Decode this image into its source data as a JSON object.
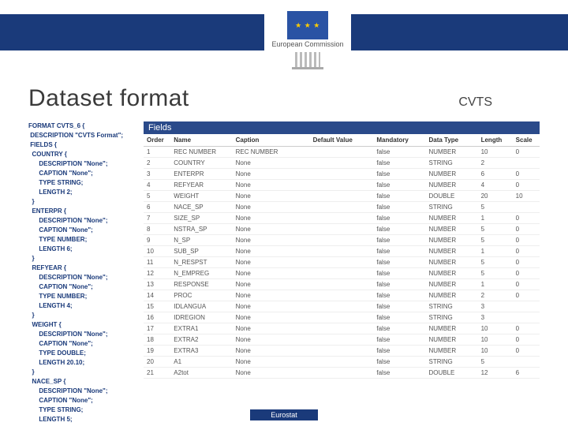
{
  "logo": {
    "caption": "European\nCommission",
    "stars": "★"
  },
  "title": "Dataset format",
  "tag": "CVTS",
  "fields_header": "Fields",
  "code_text": "FORMAT CVTS_6 {\n DESCRIPTION \"CVTS Format\";\n FIELDS {\n  COUNTRY {\n      DESCRIPTION \"None\";\n      CAPTION \"None\";\n      TYPE STRING;\n      LENGTH 2;\n  }\n  ENTERPR {\n      DESCRIPTION \"None\";\n      CAPTION \"None\";\n      TYPE NUMBER;\n      LENGTH 6;\n  }\n  REFYEAR {\n      DESCRIPTION \"None\";\n      CAPTION \"None\";\n      TYPE NUMBER;\n      LENGTH 4;\n  }\n  WEIGHT {\n      DESCRIPTION \"None\";\n      CAPTION \"None\";\n      TYPE DOUBLE;\n      LENGTH 20.10;\n  }\n  NACE_SP {\n      DESCRIPTION \"None\";\n      CAPTION \"None\";\n      TYPE STRING;\n      LENGTH 5;\n",
  "columns": [
    "Order",
    "Name",
    "Caption",
    "Default Value",
    "Mandatory",
    "Data Type",
    "Length",
    "Scale"
  ],
  "rows": [
    {
      "order": 1,
      "name": "REC NUMBER",
      "caption": "REC NUMBER",
      "def": "",
      "mand": "false",
      "type": "NUMBER",
      "len": "10",
      "sca": "0"
    },
    {
      "order": 2,
      "name": "COUNTRY",
      "caption": "None",
      "def": "",
      "mand": "false",
      "type": "STRING",
      "len": "2",
      "sca": ""
    },
    {
      "order": 3,
      "name": "ENTERPR",
      "caption": "None",
      "def": "",
      "mand": "false",
      "type": "NUMBER",
      "len": "6",
      "sca": "0"
    },
    {
      "order": 4,
      "name": "REFYEAR",
      "caption": "None",
      "def": "",
      "mand": "false",
      "type": "NUMBER",
      "len": "4",
      "sca": "0"
    },
    {
      "order": 5,
      "name": "WEIGHT",
      "caption": "None",
      "def": "",
      "mand": "false",
      "type": "DOUBLE",
      "len": "20",
      "sca": "10"
    },
    {
      "order": 6,
      "name": "NACE_SP",
      "caption": "None",
      "def": "",
      "mand": "false",
      "type": "STRING",
      "len": "5",
      "sca": ""
    },
    {
      "order": 7,
      "name": "SIZE_SP",
      "caption": "None",
      "def": "",
      "mand": "false",
      "type": "NUMBER",
      "len": "1",
      "sca": "0"
    },
    {
      "order": 8,
      "name": "NSTRA_SP",
      "caption": "None",
      "def": "",
      "mand": "false",
      "type": "NUMBER",
      "len": "5",
      "sca": "0"
    },
    {
      "order": 9,
      "name": "N_SP",
      "caption": "None",
      "def": "",
      "mand": "false",
      "type": "NUMBER",
      "len": "5",
      "sca": "0"
    },
    {
      "order": 10,
      "name": "SUB_SP",
      "caption": "None",
      "def": "",
      "mand": "false",
      "type": "NUMBER",
      "len": "1",
      "sca": "0"
    },
    {
      "order": 11,
      "name": "N_RESPST",
      "caption": "None",
      "def": "",
      "mand": "false",
      "type": "NUMBER",
      "len": "5",
      "sca": "0"
    },
    {
      "order": 12,
      "name": "N_EMPREG",
      "caption": "None",
      "def": "",
      "mand": "false",
      "type": "NUMBER",
      "len": "5",
      "sca": "0"
    },
    {
      "order": 13,
      "name": "RESPONSE",
      "caption": "None",
      "def": "",
      "mand": "false",
      "type": "NUMBER",
      "len": "1",
      "sca": "0"
    },
    {
      "order": 14,
      "name": "PROC",
      "caption": "None",
      "def": "",
      "mand": "false",
      "type": "NUMBER",
      "len": "2",
      "sca": "0"
    },
    {
      "order": 15,
      "name": "IDLANGUA",
      "caption": "None",
      "def": "",
      "mand": "false",
      "type": "STRING",
      "len": "3",
      "sca": ""
    },
    {
      "order": 16,
      "name": "IDREGION",
      "caption": "None",
      "def": "",
      "mand": "false",
      "type": "STRING",
      "len": "3",
      "sca": ""
    },
    {
      "order": 17,
      "name": "EXTRA1",
      "caption": "None",
      "def": "",
      "mand": "false",
      "type": "NUMBER",
      "len": "10",
      "sca": "0"
    },
    {
      "order": 18,
      "name": "EXTRA2",
      "caption": "None",
      "def": "",
      "mand": "false",
      "type": "NUMBER",
      "len": "10",
      "sca": "0"
    },
    {
      "order": 19,
      "name": "EXTRA3",
      "caption": "None",
      "def": "",
      "mand": "false",
      "type": "NUMBER",
      "len": "10",
      "sca": "0"
    },
    {
      "order": 20,
      "name": "A1",
      "caption": "None",
      "def": "",
      "mand": "false",
      "type": "STRING",
      "len": "5",
      "sca": ""
    },
    {
      "order": 21,
      "name": "A2tot",
      "caption": "None",
      "def": "",
      "mand": "false",
      "type": "DOUBLE",
      "len": "12",
      "sca": "6"
    }
  ],
  "footer": "Eurostat"
}
